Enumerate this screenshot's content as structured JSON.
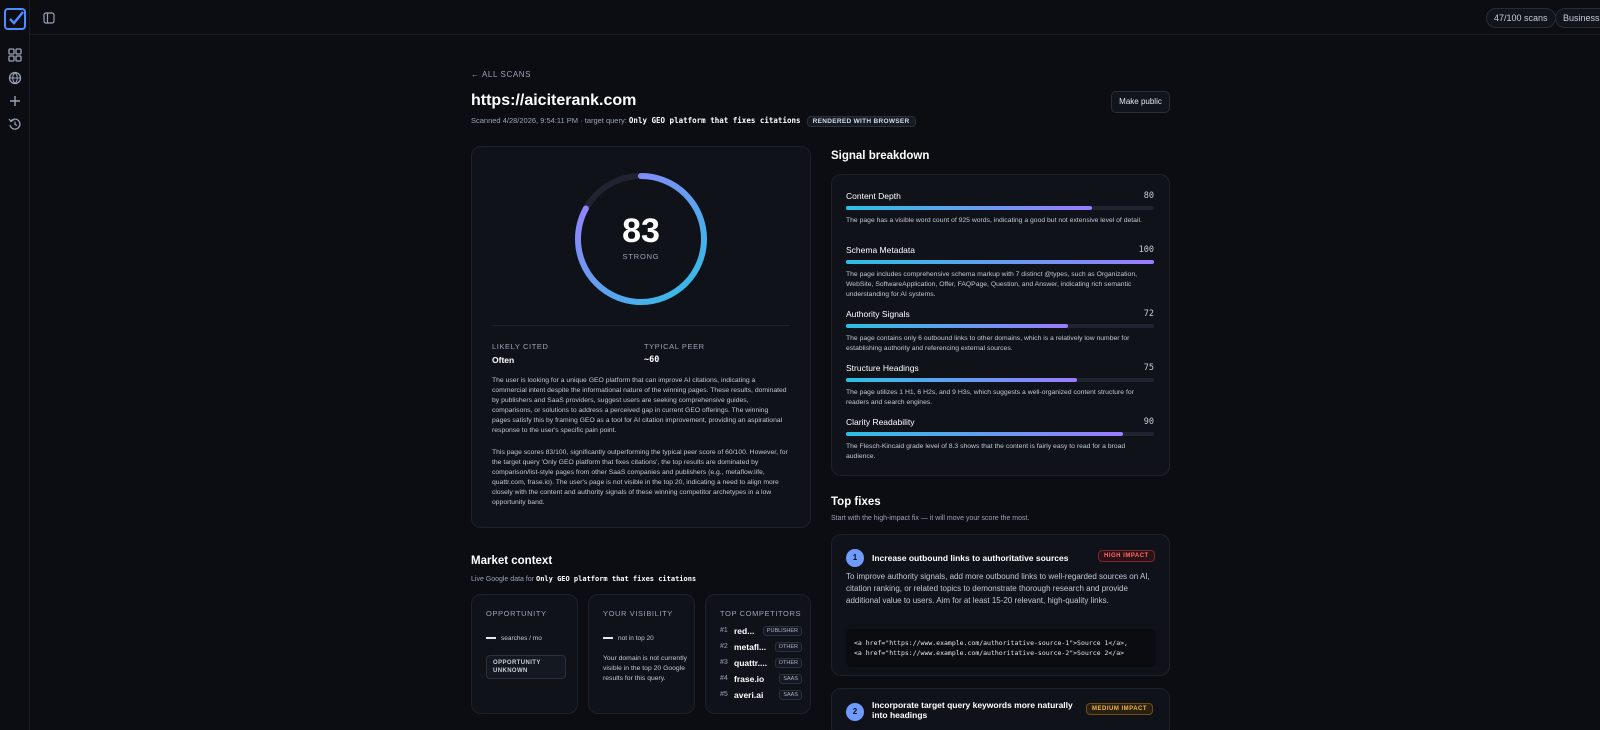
{
  "topbar": {
    "scans": "47/100 scans",
    "plan": "Business"
  },
  "nav": {
    "back": "← ALL SCANS"
  },
  "header": {
    "title": "https://aiciterank.com",
    "scanned": "Scanned 4/28/2026, 9:54:11 PM",
    "query_prefix": "· target query:",
    "query": "Only GEO platform that fixes citations",
    "render_badge": "RENDERED WITH BROWSER",
    "make_public": "Make public"
  },
  "score": {
    "value": "83",
    "value_fraction": 0.83,
    "label": "STRONG",
    "likely_cited_label": "LIKELY CITED",
    "likely_cited_value": "Often",
    "typical_peer_label": "TYPICAL PEER",
    "typical_peer_value": "~60",
    "paragraph_1": "The user is looking for a unique GEO platform that can improve AI citations, indicating a commercial intent despite the informational nature of the winning pages. These results, dominated by publishers and SaaS providers, suggest users are seeking comprehensive guides, comparisons, or solutions to address a perceived gap in current GEO offerings. The winning pages satisfy this by framing GEO as a tool for AI citation improvement, providing an aspirational response to the user's specific pain point.",
    "paragraph_2": "This page scores 83/100, significantly outperforming the typical peer score of 60/100. However, for the target query 'Only GEO platform that fixes citations', the top results are dominated by comparison/list-style pages from other SaaS companies and publishers (e.g., metaflow.life, quattr.com, frase.io). The user's page is not visible in the top 20, indicating a need to align more closely with the content and authority signals of these winning competitor archetypes in a low opportunity band."
  },
  "market": {
    "title": "Market context",
    "sub_prefix": "Live Google data for",
    "sub_query": "Only GEO platform that fixes citations",
    "opportunity": {
      "head": "OPPORTUNITY",
      "line": "searches / mo",
      "badge": "OPPORTUNITY UNKNOWN"
    },
    "visibility": {
      "head": "YOUR VISIBILITY",
      "line": "not in top 20",
      "text": "Your domain is not currently visible in the top 20 Google results for this query."
    },
    "competitors": {
      "head": "TOP COMPETITORS",
      "items": [
        {
          "rank": "#1",
          "name": "red...",
          "tag": "PUBLISHER"
        },
        {
          "rank": "#2",
          "name": "metafl...",
          "tag": "OTHER"
        },
        {
          "rank": "#3",
          "name": "quattr....",
          "tag": "OTHER"
        },
        {
          "rank": "#4",
          "name": "frase.io",
          "tag": "SAAS"
        },
        {
          "rank": "#5",
          "name": "averi.ai",
          "tag": "SAAS"
        }
      ]
    }
  },
  "signals": {
    "title": "Signal breakdown",
    "items": [
      {
        "name": "Content Depth",
        "value": "80",
        "pct": 80,
        "desc": "The page has a visible word count of 925 words, indicating a good but not extensive level of detail."
      },
      {
        "name": "Schema Metadata",
        "value": "100",
        "pct": 100,
        "desc": "The page includes comprehensive schema markup with 7 distinct @types, such as Organization, WebSite, SoftwareApplication, Offer, FAQPage, Question, and Answer, indicating rich semantic understanding for AI systems."
      },
      {
        "name": "Authority Signals",
        "value": "72",
        "pct": 72,
        "desc": "The page contains only 6 outbound links to other domains, which is a relatively low number for establishing authority and referencing external sources."
      },
      {
        "name": "Structure Headings",
        "value": "75",
        "pct": 75,
        "desc": "The page utilizes 1 H1, 6 H2s, and 9 H3s, which suggests a well-organized content structure for readers and search engines."
      },
      {
        "name": "Clarity Readability",
        "value": "90",
        "pct": 90,
        "desc": "The Flesch-Kincaid grade level of 8.3 shows that the content is fairly easy to read for a broad audience."
      }
    ]
  },
  "fixes": {
    "title": "Top fixes",
    "sub": "Start with the high-impact fix — it will move your score the most.",
    "items": [
      {
        "num": "1",
        "title": "Increase outbound links to authoritative sources",
        "impact": "HIGH IMPACT",
        "desc": "To improve authority signals, add more outbound links to well-regarded sources on AI, citation ranking, or related topics to demonstrate thorough research and provide additional value to users. Aim for at least 15-20 relevant, high-quality links.",
        "code_1": "<a href=\"https://www.example.com/authoritative-source-1\">Source 1</a>,",
        "code_2": "<a href=\"https://www.example.com/authoritative-source-2\">Source 2</a>"
      },
      {
        "num": "2",
        "title_1": "Incorporate target query keywords more naturally",
        "title_2": "into headings",
        "impact": "MEDIUM IMPACT"
      }
    ]
  },
  "colors": {
    "accent_start": "#2bc0e4",
    "accent_end": "#9b7bff",
    "high": "#ff6b6b",
    "medium": "#f0b44a"
  }
}
